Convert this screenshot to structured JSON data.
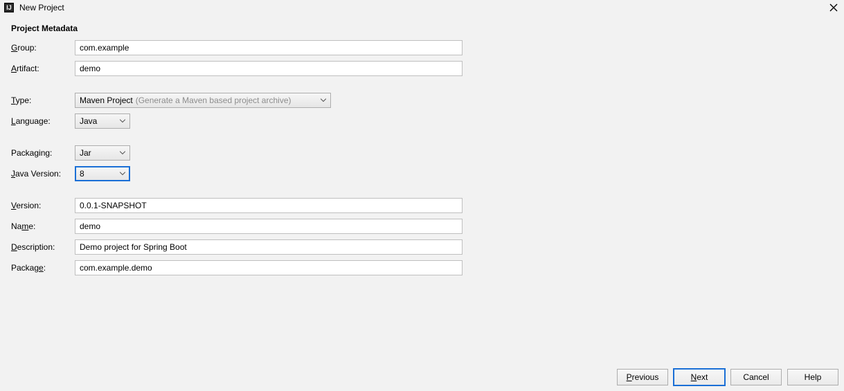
{
  "window": {
    "title": "New Project",
    "app_icon_glyph": "IJ"
  },
  "section": {
    "title": "Project Metadata"
  },
  "labels": {
    "group": {
      "u": "G",
      "rest": "roup:"
    },
    "artifact": {
      "u": "A",
      "rest": "rtifact:"
    },
    "type": {
      "u": "T",
      "rest": "ype:"
    },
    "language": {
      "u": "L",
      "rest": "anguage:"
    },
    "packaging": {
      "plain": "Packaging:"
    },
    "java_version": {
      "u": "J",
      "rest": "ava Version:"
    },
    "version": {
      "u": "V",
      "rest": "ersion:"
    },
    "name": {
      "plain": "Na",
      "u": "m",
      "rest": "e:"
    },
    "description": {
      "u": "D",
      "rest": "escription:"
    },
    "package": {
      "plain": "Packag",
      "u": "e",
      "rest": ":"
    }
  },
  "fields": {
    "group": "com.example",
    "artifact": "demo",
    "type": {
      "value": "Maven Project",
      "hint": "(Generate a Maven based project archive)"
    },
    "language": "Java",
    "packaging": "Jar",
    "java_version": "8",
    "version": "0.0.1-SNAPSHOT",
    "name": "demo",
    "description": "Demo project for Spring Boot",
    "package": "com.example.demo"
  },
  "buttons": {
    "previous": {
      "u": "P",
      "rest": "revious"
    },
    "next": {
      "u": "N",
      "rest": "ext"
    },
    "cancel": {
      "plain": "Cancel"
    },
    "help": {
      "plain": "Help"
    }
  }
}
